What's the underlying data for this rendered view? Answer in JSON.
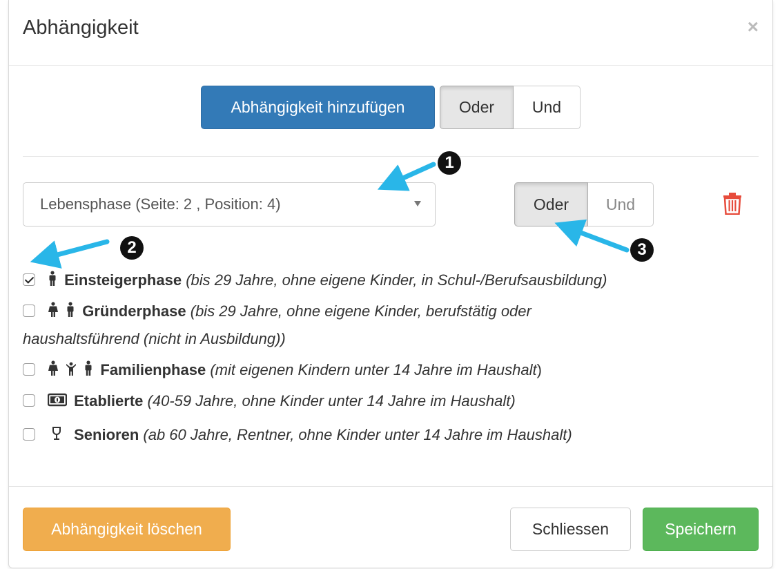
{
  "dialog": {
    "title": "Abhängigkeit",
    "close_symbol": "×"
  },
  "top_bar": {
    "add_label": "Abhängigkeit hinzufügen",
    "oder_label": "Oder",
    "und_label": "Und",
    "active": "Oder"
  },
  "condition": {
    "select_value": "Lebensphase (Seite: 2 , Position: 4)",
    "oder_label": "Oder",
    "und_label": "Und",
    "active": "Oder"
  },
  "options": [
    {
      "checked": true,
      "icons": [
        "male-icon"
      ],
      "name": "Einsteigerphase",
      "desc": "(bis 29 Jahre, ohne eigene Kinder, in Schul-/Berufsausbildung)",
      "desc2": ""
    },
    {
      "checked": false,
      "icons": [
        "female-icon",
        "male-icon"
      ],
      "name": "Gründerphase",
      "desc": "(bis 29 Jahre, ohne eigene Kinder, berufstätig oder",
      "desc2": "haushaltsführend (nicht in Ausbildung))"
    },
    {
      "checked": false,
      "icons": [
        "female-icon",
        "child-icon",
        "male-icon"
      ],
      "name": "Familienphase",
      "desc": "(mit eigenen Kindern unter 14 Jahre im Haushalt",
      "desc_tail": ")"
    },
    {
      "checked": false,
      "icons": [
        "money-icon"
      ],
      "name": "Etablierte",
      "desc": "(40-59 Jahre, ohne Kinder unter 14 Jahre im Haushalt)",
      "desc2": ""
    },
    {
      "checked": false,
      "icons": [
        "glass-icon"
      ],
      "name": "Senioren",
      "desc": "(ab 60 Jahre, Rentner, ohne Kinder unter 14 Jahre im Haushalt)",
      "desc2": ""
    }
  ],
  "annotations": [
    "1",
    "2",
    "3"
  ],
  "footer": {
    "delete_label": "Abhängigkeit löschen",
    "close_label": "Schliessen",
    "save_label": "Speichern"
  },
  "colors": {
    "primary": "#337ab7",
    "warning": "#f0ad4e",
    "success": "#5cb85c",
    "danger": "#e74c3c",
    "annotation_arrow": "#29b6e8"
  }
}
